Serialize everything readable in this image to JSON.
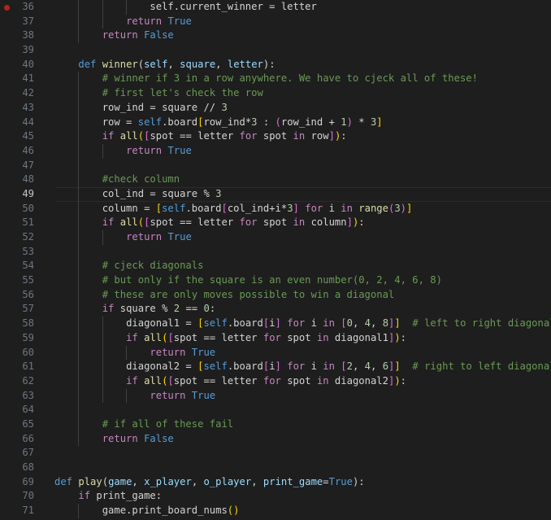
{
  "editor": {
    "breakpoint_line": 36,
    "current_line": 49,
    "colors": {
      "keyword": "#569cd6",
      "control": "#c586c0",
      "function": "#dcdcaa",
      "variable": "#9cdcfe",
      "comment": "#6a9955",
      "number": "#b5cea8",
      "breakpoint": "#b42318"
    },
    "lines": [
      {
        "n": "36",
        "indent": 4,
        "tokens": [
          [
            "self.current_winner = letter",
            "t-op"
          ]
        ]
      },
      {
        "n": "37",
        "indent": 3,
        "tokens": [
          [
            "return",
            "t-ctl"
          ],
          [
            " ",
            ""
          ],
          [
            "True",
            "t-kw"
          ]
        ]
      },
      {
        "n": "38",
        "indent": 2,
        "tokens": [
          [
            "return",
            "t-ctl"
          ],
          [
            " ",
            ""
          ],
          [
            "False",
            "t-kw"
          ]
        ]
      },
      {
        "n": "39",
        "indent": 0,
        "tokens": []
      },
      {
        "n": "40",
        "indent": 1,
        "tokens": [
          [
            "def",
            "t-kw"
          ],
          [
            " ",
            ""
          ],
          [
            "winner",
            "t-fn"
          ],
          [
            "(",
            ""
          ],
          [
            "self",
            "t-var"
          ],
          [
            ", ",
            ""
          ],
          [
            "square",
            "t-var"
          ],
          [
            ", ",
            ""
          ],
          [
            "letter",
            "t-var"
          ],
          [
            "):",
            ""
          ]
        ]
      },
      {
        "n": "41",
        "indent": 2,
        "tokens": [
          [
            "# winner if 3 in a row anywhere. We have to cjeck all of these!",
            "t-cm"
          ]
        ]
      },
      {
        "n": "42",
        "indent": 2,
        "tokens": [
          [
            "# first let's check the row",
            "t-cm"
          ]
        ]
      },
      {
        "n": "43",
        "indent": 2,
        "tokens": [
          [
            "row_ind = square // ",
            "t-op"
          ],
          [
            "3",
            "t-num"
          ]
        ]
      },
      {
        "n": "44",
        "indent": 2,
        "tokens": [
          [
            "row = ",
            "t-op"
          ],
          [
            "self",
            "t-kw"
          ],
          [
            ".board",
            "t-op"
          ],
          [
            "[",
            "t-br"
          ],
          [
            "row_ind*",
            "t-op"
          ],
          [
            "3",
            "t-num"
          ],
          [
            " : ",
            "t-op"
          ],
          [
            "(",
            "t-br2"
          ],
          [
            "row_ind + ",
            "t-op"
          ],
          [
            "1",
            "t-num"
          ],
          [
            ")",
            "t-br2"
          ],
          [
            " * ",
            "t-op"
          ],
          [
            "3",
            "t-num"
          ],
          [
            "]",
            "t-br"
          ]
        ]
      },
      {
        "n": "45",
        "indent": 2,
        "tokens": [
          [
            "if",
            "t-ctl"
          ],
          [
            " ",
            ""
          ],
          [
            "all",
            "t-fn"
          ],
          [
            "(",
            "t-br"
          ],
          [
            "[",
            "t-br2"
          ],
          [
            "spot == letter ",
            "t-op"
          ],
          [
            "for",
            "t-ctl"
          ],
          [
            " spot ",
            "t-op"
          ],
          [
            "in",
            "t-ctl"
          ],
          [
            " row",
            "t-op"
          ],
          [
            "]",
            "t-br2"
          ],
          [
            ")",
            "t-br"
          ],
          [
            ":",
            "t-op"
          ]
        ]
      },
      {
        "n": "46",
        "indent": 3,
        "tokens": [
          [
            "return",
            "t-ctl"
          ],
          [
            " ",
            ""
          ],
          [
            "True",
            "t-kw"
          ]
        ]
      },
      {
        "n": "47",
        "indent": 0,
        "tokens": []
      },
      {
        "n": "48",
        "indent": 2,
        "tokens": [
          [
            "#check column",
            "t-cm"
          ]
        ]
      },
      {
        "n": "49",
        "indent": 2,
        "tokens": [
          [
            "col_ind = square % ",
            "t-op"
          ],
          [
            "3",
            "t-num"
          ]
        ]
      },
      {
        "n": "50",
        "indent": 2,
        "tokens": [
          [
            "column = ",
            "t-op"
          ],
          [
            "[",
            "t-br"
          ],
          [
            "self",
            "t-kw"
          ],
          [
            ".board",
            "t-op"
          ],
          [
            "[",
            "t-br2"
          ],
          [
            "col_ind+i*",
            "t-op"
          ],
          [
            "3",
            "t-num"
          ],
          [
            "]",
            "t-br2"
          ],
          [
            " ",
            ""
          ],
          [
            "for",
            "t-ctl"
          ],
          [
            " i ",
            "t-op"
          ],
          [
            "in",
            "t-ctl"
          ],
          [
            " ",
            ""
          ],
          [
            "range",
            "t-fn"
          ],
          [
            "(",
            "t-br2"
          ],
          [
            "3",
            "t-num"
          ],
          [
            ")",
            "t-br2"
          ],
          [
            "]",
            "t-br"
          ]
        ]
      },
      {
        "n": "51",
        "indent": 2,
        "tokens": [
          [
            "if",
            "t-ctl"
          ],
          [
            " ",
            ""
          ],
          [
            "all",
            "t-fn"
          ],
          [
            "(",
            "t-br"
          ],
          [
            "[",
            "t-br2"
          ],
          [
            "spot == letter ",
            "t-op"
          ],
          [
            "for",
            "t-ctl"
          ],
          [
            " spot ",
            "t-op"
          ],
          [
            "in",
            "t-ctl"
          ],
          [
            " column",
            "t-op"
          ],
          [
            "]",
            "t-br2"
          ],
          [
            ")",
            "t-br"
          ],
          [
            ":",
            "t-op"
          ]
        ]
      },
      {
        "n": "52",
        "indent": 3,
        "tokens": [
          [
            "return",
            "t-ctl"
          ],
          [
            " ",
            ""
          ],
          [
            "True",
            "t-kw"
          ]
        ]
      },
      {
        "n": "53",
        "indent": 0,
        "tokens": []
      },
      {
        "n": "54",
        "indent": 2,
        "tokens": [
          [
            "# cjeck diagonals",
            "t-cm"
          ]
        ]
      },
      {
        "n": "55",
        "indent": 2,
        "tokens": [
          [
            "# but only if the square is an even number(0, 2, 4, 6, 8)",
            "t-cm"
          ]
        ]
      },
      {
        "n": "56",
        "indent": 2,
        "tokens": [
          [
            "# these are only moves possible to win a diagonal",
            "t-cm"
          ]
        ]
      },
      {
        "n": "57",
        "indent": 2,
        "tokens": [
          [
            "if",
            "t-ctl"
          ],
          [
            " square % ",
            "t-op"
          ],
          [
            "2",
            "t-num"
          ],
          [
            " == ",
            "t-op"
          ],
          [
            "0",
            "t-num"
          ],
          [
            ":",
            "t-op"
          ]
        ]
      },
      {
        "n": "58",
        "indent": 3,
        "tokens": [
          [
            "diagonal1 = ",
            "t-op"
          ],
          [
            "[",
            "t-br"
          ],
          [
            "self",
            "t-kw"
          ],
          [
            ".board",
            "t-op"
          ],
          [
            "[",
            "t-br2"
          ],
          [
            "i",
            "t-op"
          ],
          [
            "]",
            "t-br2"
          ],
          [
            " ",
            ""
          ],
          [
            "for",
            "t-ctl"
          ],
          [
            " i ",
            "t-op"
          ],
          [
            "in",
            "t-ctl"
          ],
          [
            " ",
            ""
          ],
          [
            "[",
            "t-br2"
          ],
          [
            "0",
            "t-num"
          ],
          [
            ", ",
            "t-op"
          ],
          [
            "4",
            "t-num"
          ],
          [
            ", ",
            "t-op"
          ],
          [
            "8",
            "t-num"
          ],
          [
            "]",
            "t-br2"
          ],
          [
            "]",
            "t-br"
          ],
          [
            "  ",
            ""
          ],
          [
            "# left to right diagonals",
            "t-cm"
          ]
        ]
      },
      {
        "n": "59",
        "indent": 3,
        "tokens": [
          [
            "if",
            "t-ctl"
          ],
          [
            " ",
            ""
          ],
          [
            "all",
            "t-fn"
          ],
          [
            "(",
            "t-br"
          ],
          [
            "[",
            "t-br2"
          ],
          [
            "spot == letter ",
            "t-op"
          ],
          [
            "for",
            "t-ctl"
          ],
          [
            " spot ",
            "t-op"
          ],
          [
            "in",
            "t-ctl"
          ],
          [
            " diagonal1",
            "t-op"
          ],
          [
            "]",
            "t-br2"
          ],
          [
            ")",
            "t-br"
          ],
          [
            ":",
            "t-op"
          ]
        ]
      },
      {
        "n": "60",
        "indent": 4,
        "tokens": [
          [
            "return",
            "t-ctl"
          ],
          [
            " ",
            ""
          ],
          [
            "True",
            "t-kw"
          ]
        ]
      },
      {
        "n": "61",
        "indent": 3,
        "tokens": [
          [
            "diagonal2 = ",
            "t-op"
          ],
          [
            "[",
            "t-br"
          ],
          [
            "self",
            "t-kw"
          ],
          [
            ".board",
            "t-op"
          ],
          [
            "[",
            "t-br2"
          ],
          [
            "i",
            "t-op"
          ],
          [
            "]",
            "t-br2"
          ],
          [
            " ",
            ""
          ],
          [
            "for",
            "t-ctl"
          ],
          [
            " i ",
            "t-op"
          ],
          [
            "in",
            "t-ctl"
          ],
          [
            " ",
            ""
          ],
          [
            "[",
            "t-br2"
          ],
          [
            "2",
            "t-num"
          ],
          [
            ", ",
            "t-op"
          ],
          [
            "4",
            "t-num"
          ],
          [
            ", ",
            "t-op"
          ],
          [
            "6",
            "t-num"
          ],
          [
            "]",
            "t-br2"
          ],
          [
            "]",
            "t-br"
          ],
          [
            "  ",
            ""
          ],
          [
            "# right to left diagonals",
            "t-cm"
          ]
        ]
      },
      {
        "n": "62",
        "indent": 3,
        "tokens": [
          [
            "if",
            "t-ctl"
          ],
          [
            " ",
            ""
          ],
          [
            "all",
            "t-fn"
          ],
          [
            "(",
            "t-br"
          ],
          [
            "[",
            "t-br2"
          ],
          [
            "spot == letter ",
            "t-op"
          ],
          [
            "for",
            "t-ctl"
          ],
          [
            " spot ",
            "t-op"
          ],
          [
            "in",
            "t-ctl"
          ],
          [
            " diagonal2",
            "t-op"
          ],
          [
            "]",
            "t-br2"
          ],
          [
            ")",
            "t-br"
          ],
          [
            ":",
            "t-op"
          ]
        ]
      },
      {
        "n": "63",
        "indent": 4,
        "tokens": [
          [
            "return",
            "t-ctl"
          ],
          [
            " ",
            ""
          ],
          [
            "True",
            "t-kw"
          ]
        ]
      },
      {
        "n": "64",
        "indent": 0,
        "tokens": []
      },
      {
        "n": "65",
        "indent": 2,
        "tokens": [
          [
            "# if all of these fail",
            "t-cm"
          ]
        ]
      },
      {
        "n": "66",
        "indent": 2,
        "tokens": [
          [
            "return",
            "t-ctl"
          ],
          [
            " ",
            ""
          ],
          [
            "False",
            "t-kw"
          ]
        ]
      },
      {
        "n": "67",
        "indent": 0,
        "tokens": []
      },
      {
        "n": "68",
        "indent": 0,
        "tokens": []
      },
      {
        "n": "69",
        "indent": 0,
        "tokens": [
          [
            "def",
            "t-kw"
          ],
          [
            " ",
            ""
          ],
          [
            "play",
            "t-fn"
          ],
          [
            "(",
            ""
          ],
          [
            "game",
            "t-var"
          ],
          [
            ", ",
            ""
          ],
          [
            "x_player",
            "t-var"
          ],
          [
            ", ",
            ""
          ],
          [
            "o_player",
            "t-var"
          ],
          [
            ", ",
            ""
          ],
          [
            "print_game",
            "t-var"
          ],
          [
            "=",
            ""
          ],
          [
            "True",
            "t-kw"
          ],
          [
            "):",
            ""
          ]
        ]
      },
      {
        "n": "70",
        "indent": 1,
        "tokens": [
          [
            "if",
            "t-ctl"
          ],
          [
            " print_game:",
            "t-op"
          ]
        ]
      },
      {
        "n": "71",
        "indent": 2,
        "tokens": [
          [
            "game.print_board_nums",
            "t-op"
          ],
          [
            "()",
            "t-br"
          ]
        ]
      }
    ]
  }
}
